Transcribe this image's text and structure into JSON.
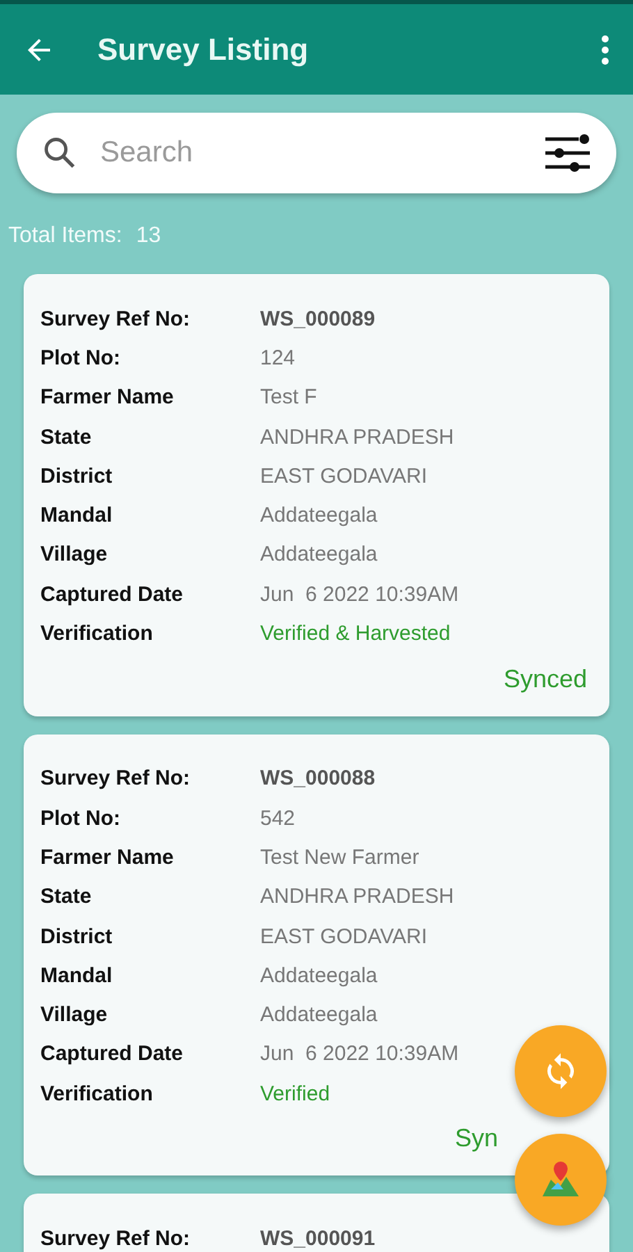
{
  "app_bar": {
    "title": "Survey Listing"
  },
  "search": {
    "placeholder": "Search"
  },
  "total": {
    "label": "Total Items:",
    "count": "13"
  },
  "cards": [
    {
      "fields": [
        {
          "label": "Survey Ref No:",
          "value": "WS_000089",
          "kind": "ref"
        },
        {
          "label": "Plot No:",
          "value": "124",
          "kind": "plain"
        },
        {
          "label": "Farmer Name",
          "value": "Test F",
          "kind": "plain"
        },
        {
          "label": "State",
          "value": "ANDHRA PRADESH",
          "kind": "plain"
        },
        {
          "label": "District",
          "value": "EAST GODAVARI",
          "kind": "plain"
        },
        {
          "label": "Mandal",
          "value": "Addateegala",
          "kind": "plain"
        },
        {
          "label": "Village",
          "value": "Addateegala",
          "kind": "plain"
        },
        {
          "label": "Captured Date",
          "value": "Jun  6 2022 10:39AM",
          "kind": "plain"
        },
        {
          "label": "Verification",
          "value": "Verified & Harvested",
          "kind": "status"
        }
      ],
      "sync_status": "Synced"
    },
    {
      "fields": [
        {
          "label": "Survey Ref No:",
          "value": "WS_000088",
          "kind": "ref"
        },
        {
          "label": "Plot No:",
          "value": "542",
          "kind": "plain"
        },
        {
          "label": "Farmer Name",
          "value": "Test New Farmer",
          "kind": "plain"
        },
        {
          "label": "State",
          "value": "ANDHRA PRADESH",
          "kind": "plain"
        },
        {
          "label": "District",
          "value": "EAST GODAVARI",
          "kind": "plain"
        },
        {
          "label": "Mandal",
          "value": "Addateegala",
          "kind": "plain"
        },
        {
          "label": "Village",
          "value": "Addateegala",
          "kind": "plain"
        },
        {
          "label": "Captured Date",
          "value": "Jun  6 2022 10:39AM",
          "kind": "plain"
        },
        {
          "label": "Verification",
          "value": "Verified",
          "kind": "status"
        }
      ],
      "sync_status": "Syn"
    },
    {
      "fields": [
        {
          "label": "Survey Ref No:",
          "value": "WS_000091",
          "kind": "ref"
        }
      ]
    }
  ]
}
